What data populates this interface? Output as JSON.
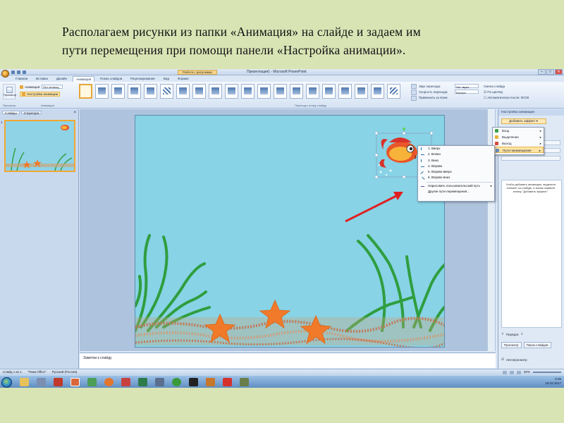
{
  "caption": {
    "line1": "Располагаем рисунки из папки «Анимация» на слайде и задаем им",
    "line2": "пути перемещения при помощи панели «Настройка анимации»."
  },
  "window": {
    "contextual_tab": "Работа с рисунками",
    "title": "Презентация1 - Microsoft PowerPoint",
    "controls": [
      "–",
      "□",
      "✕"
    ]
  },
  "ribbon_tabs": [
    "Главная",
    "Вставка",
    "Дизайн",
    "Анимация",
    "Показ слайдов",
    "Рецензирование",
    "Вид",
    "Формат"
  ],
  "active_tab": "Анимация",
  "ribbon": {
    "preview_group": "Просмотр",
    "preview_btn": "Просмотр",
    "animation_label": "Анимация:",
    "animation_value": "Без анимац...",
    "custom_animation": "Настройка анимации",
    "animation_group": "Анимация",
    "transition_group": "Переход к этому слайду",
    "transition_sound": "Звук перехода:",
    "transition_sound_value": "Нет звука",
    "transition_speed": "Скорость перехода:",
    "transition_speed_value": "Быстро",
    "apply_all": "Применить ко всем",
    "advance_slide": "Смена слайда",
    "on_click": "По щелчку",
    "auto_after": "Автоматически после:",
    "auto_after_value": "00:00"
  },
  "left_pane": {
    "tab_slides": "Слайды",
    "tab_outline": "Структура",
    "close": "×",
    "slide_number": "1"
  },
  "notes_placeholder": "Заметки к слайду",
  "task_pane": {
    "title": "Настройка анимации",
    "add_effect": "Добавить эффект",
    "hint": "Чтобы добавить анимацию, выделите элемент на слайде, а затем нажмите кнопку \"Добавить эффект\".",
    "reorder": "Порядок",
    "play": "Просмотр",
    "slide_show": "Показ слайдов",
    "autopreview": "Автопросмотр"
  },
  "effect_menu": [
    {
      "label": "Вход",
      "color": "#3aa14a"
    },
    {
      "label": "Выделение",
      "color": "#e4b434"
    },
    {
      "label": "Выход",
      "color": "#d64a3a"
    },
    {
      "label": "Пути перемещения",
      "color": "#6c8ebf"
    }
  ],
  "path_menu": [
    "1. Вверх",
    "2. Влево",
    "3. Вниз",
    "4. Вправо",
    "5. Вправо-вверх",
    "6. Вправо-вниз",
    "Нарисовать пользовательский путь",
    "Другие пути перемещения..."
  ],
  "status": {
    "slide": "Слайд 1 из 1",
    "theme": "\"Тема Office\"",
    "lang": "Русский (Россия)",
    "zoom": "60%"
  },
  "tray": {
    "time": "9:35",
    "date": "18.02.2017"
  },
  "colors": {
    "page_bg": "#d9e4b5",
    "slide_bg": "#88d3e6",
    "arrow": "#e02020",
    "seaweed": "#2f9e3f",
    "starfish": "#f07a2a",
    "highlight": "#fde4a5"
  }
}
